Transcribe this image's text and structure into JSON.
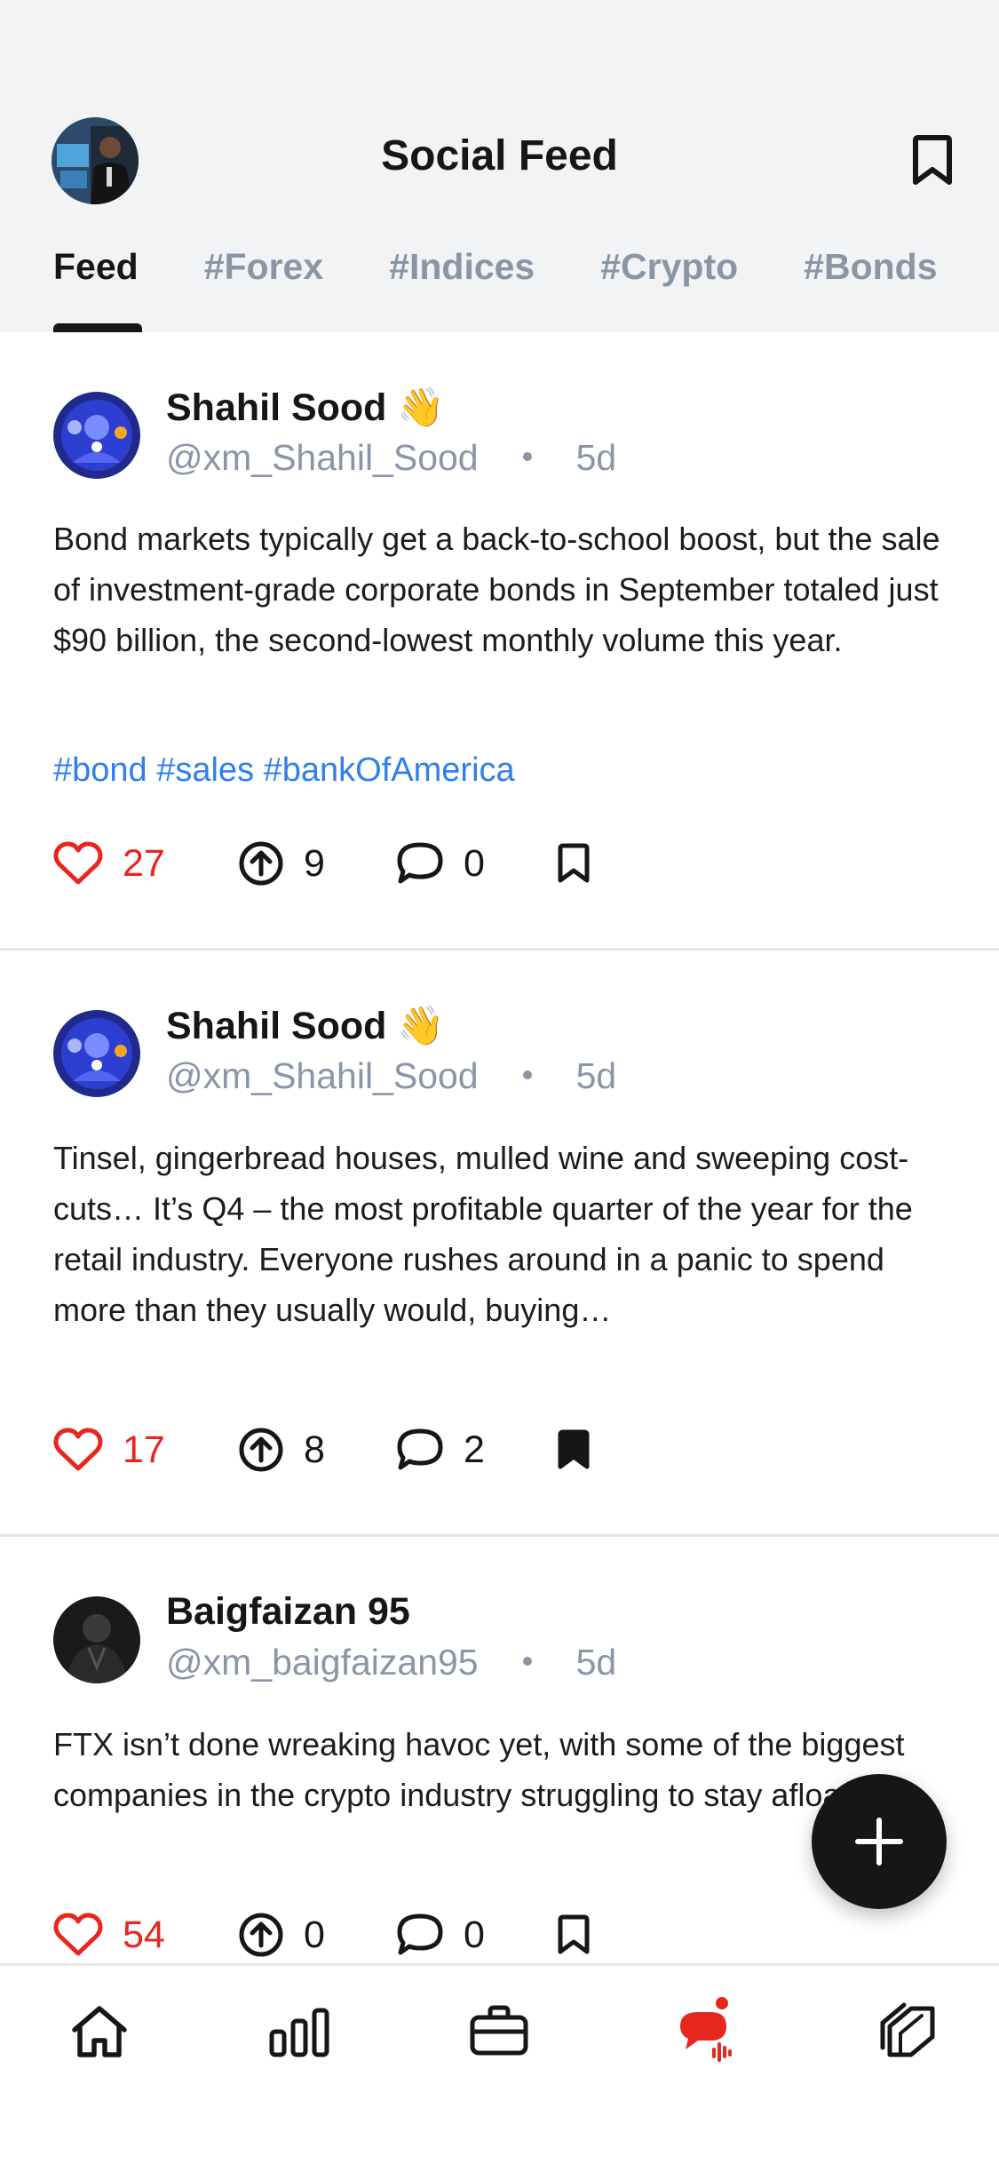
{
  "header": {
    "title": "Social Feed",
    "tabs": [
      {
        "label": "Feed",
        "active": true
      },
      {
        "label": "#Forex",
        "active": false
      },
      {
        "label": "#Indices",
        "active": false
      },
      {
        "label": "#Crypto",
        "active": false
      },
      {
        "label": "#Bonds",
        "active": false
      }
    ]
  },
  "posts": [
    {
      "name": "Shahil Sood 👋",
      "handle": "@xm_Shahil_Sood",
      "time": "5d",
      "body": "Bond markets typically get a back-to-school boost, but the sale of investment-grade corporate bonds in September totaled just $90 billion, the second-lowest monthly volume this year.",
      "tags": "#bond #sales #bankOfAmerica",
      "likes": "27",
      "shares": "9",
      "comments": "0",
      "bookmarked": false
    },
    {
      "name": "Shahil Sood 👋",
      "handle": "@xm_Shahil_Sood",
      "time": "5d",
      "body": "Tinsel, gingerbread houses, mulled wine and sweeping cost-cuts… It’s Q4 – the most profitable quarter of the year for the retail industry. Everyone rushes around in a panic to spend more than they usually would, buying…",
      "likes": "17",
      "shares": "8",
      "comments": "2",
      "bookmarked": true
    },
    {
      "name": "Baigfaizan 95",
      "handle": "@xm_baigfaizan95",
      "time": "5d",
      "body": "FTX isn’t done wreaking havoc yet, with some of the biggest companies in the crypto industry struggling to stay afloat.",
      "likes": "54",
      "shares": "0",
      "comments": "0",
      "bookmarked": false
    }
  ],
  "colors": {
    "accent_red": "#e8251f",
    "link_blue": "#2f80ed",
    "muted": "#8a96a6",
    "header_bg": "#f2f3f5"
  },
  "bottom_nav": {
    "items": [
      "home-icon",
      "markets-icon",
      "portfolio-icon",
      "social-icon",
      "instruments-icon"
    ],
    "active": "social-icon"
  }
}
